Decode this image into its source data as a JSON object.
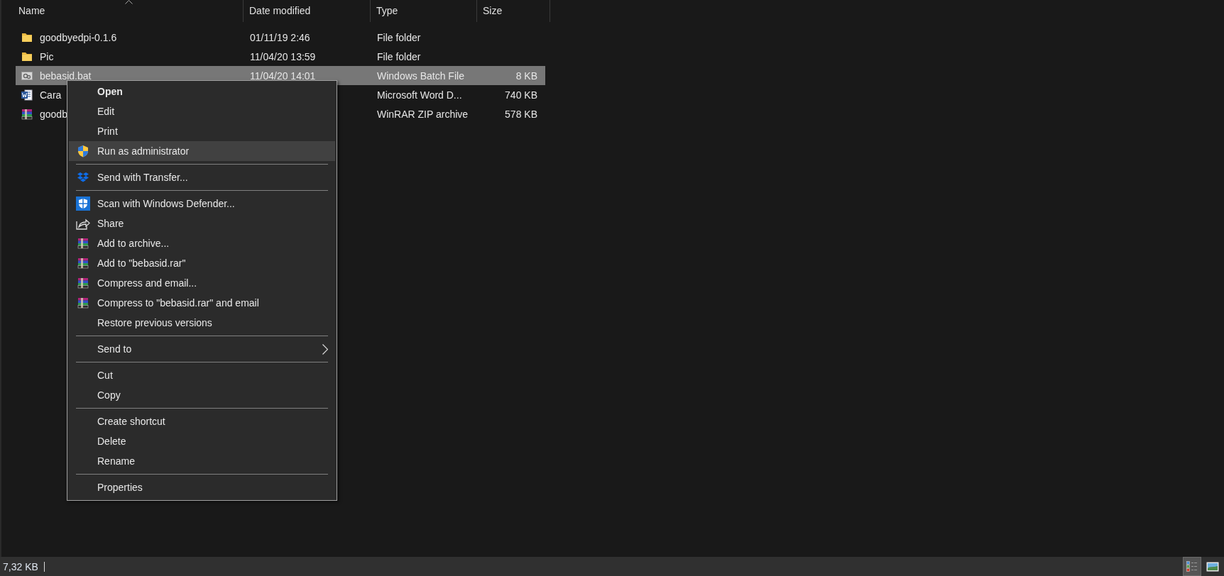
{
  "columns": [
    {
      "label": "Name",
      "sorted": true
    },
    {
      "label": "Date modified",
      "sorted": false
    },
    {
      "label": "Type",
      "sorted": false
    },
    {
      "label": "Size",
      "sorted": false
    }
  ],
  "rows": [
    {
      "kind": "folder",
      "name": "goodbyedpi-0.1.6",
      "date": "01/11/19 2:46",
      "type": "File folder",
      "selected": false
    },
    {
      "kind": "folder",
      "name": "Pic",
      "date": "11/04/20 13:59",
      "type": "File folder",
      "selected": false
    },
    {
      "kind": "batch",
      "name": "bebasid.bat",
      "date": "11/04/20 14:01",
      "type": "Windows Batch File",
      "size": "8 KB",
      "selected": true
    },
    {
      "kind": "word",
      "name": "Cara",
      "type": "Microsoft Word D...",
      "size": "740 KB",
      "selected": false
    },
    {
      "kind": "archive",
      "name": "goodb",
      "type": "WinRAR ZIP archive",
      "size": "578 KB",
      "selected": false
    }
  ],
  "context_menu": {
    "groups": [
      [
        {
          "label": "Open",
          "default": true,
          "selected": false,
          "submenu": false
        },
        {
          "label": "Edit",
          "default": false,
          "selected": false,
          "submenu": false
        },
        {
          "label": "Print",
          "default": false,
          "selected": false,
          "submenu": false
        },
        {
          "label": "Run as administrator",
          "kind": "uac",
          "default": false,
          "selected": true,
          "submenu": false
        }
      ],
      [
        {
          "label": "Send with Transfer...",
          "kind": "dropbox",
          "default": false,
          "selected": false,
          "submenu": false
        }
      ],
      [
        {
          "label": "Scan with Windows Defender...",
          "kind": "defender",
          "default": false,
          "selected": false,
          "submenu": false
        },
        {
          "label": "Share",
          "kind": "share",
          "default": false,
          "selected": false,
          "submenu": false
        },
        {
          "label": "Add to archive...",
          "kind": "archive",
          "default": false,
          "selected": false,
          "submenu": false
        },
        {
          "label": "Add to \"bebasid.rar\"",
          "kind": "archive",
          "default": false,
          "selected": false,
          "submenu": false
        },
        {
          "label": "Compress and email...",
          "kind": "archive",
          "default": false,
          "selected": false,
          "submenu": false
        },
        {
          "label": "Compress to \"bebasid.rar\" and email",
          "kind": "archive",
          "default": false,
          "selected": false,
          "submenu": false
        },
        {
          "label": "Restore previous versions",
          "default": false,
          "selected": false,
          "submenu": false
        }
      ],
      [
        {
          "label": "Send to",
          "default": false,
          "selected": false,
          "submenu": true
        }
      ],
      [
        {
          "label": "Cut",
          "default": false,
          "selected": false,
          "submenu": false
        },
        {
          "label": "Copy",
          "default": false,
          "selected": false,
          "submenu": false
        }
      ],
      [
        {
          "label": "Create shortcut",
          "default": false,
          "selected": false,
          "submenu": false
        },
        {
          "label": "Delete",
          "default": false,
          "selected": false,
          "submenu": false
        },
        {
          "label": "Rename",
          "default": false,
          "selected": false,
          "submenu": false
        }
      ],
      [
        {
          "label": "Properties",
          "default": false,
          "selected": false,
          "submenu": false
        }
      ]
    ]
  },
  "status_bar": {
    "selection_size": "7,32 KB",
    "views": [
      {
        "kind": "details",
        "selected": true
      },
      {
        "kind": "large-icons",
        "selected": false
      }
    ]
  }
}
